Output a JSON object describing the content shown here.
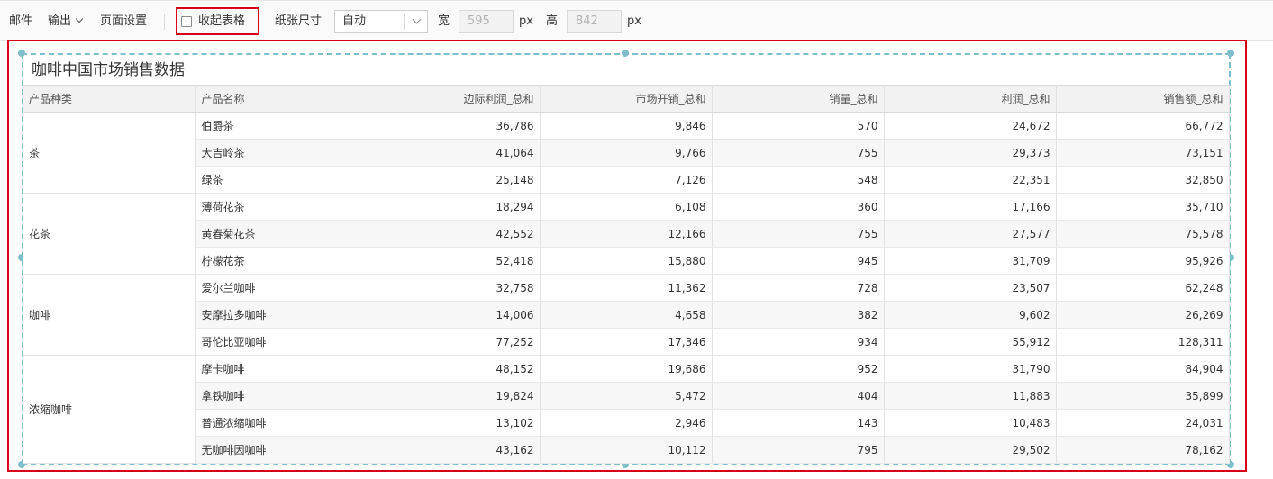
{
  "toolbar": {
    "mail": "邮件",
    "export": "输出",
    "page_settings": "页面设置",
    "collapse_table": "收起表格",
    "paper_size_label": "纸张尺寸",
    "paper_size_value": "自动",
    "width_label": "宽",
    "width_value": "595",
    "height_label": "高",
    "height_value": "842",
    "unit": "px"
  },
  "colors": {
    "highlight_border": "#d9001b",
    "selection_dashed": "#7fbfcc",
    "header_bg": "#f2f2f2",
    "stripe_bg": "#f7f7f7"
  },
  "report": {
    "title": "咖啡中国市场销售数据",
    "columns": [
      "产品种类",
      "产品名称",
      "边际利润_总和",
      "市场开销_总和",
      "销量_总和",
      "利润_总和",
      "销售额_总和"
    ],
    "groups": [
      {
        "category": "茶",
        "rows": [
          [
            "伯爵茶",
            "36,786",
            "9,846",
            "570",
            "24,672",
            "66,772"
          ],
          [
            "大吉岭茶",
            "41,064",
            "9,766",
            "755",
            "29,373",
            "73,151"
          ],
          [
            "绿茶",
            "25,148",
            "7,126",
            "548",
            "22,351",
            "32,850"
          ]
        ]
      },
      {
        "category": "花茶",
        "rows": [
          [
            "薄荷花茶",
            "18,294",
            "6,108",
            "360",
            "17,166",
            "35,710"
          ],
          [
            "黄春菊花茶",
            "42,552",
            "12,166",
            "755",
            "27,577",
            "75,578"
          ],
          [
            "柠檬花茶",
            "52,418",
            "15,880",
            "945",
            "31,709",
            "95,926"
          ]
        ]
      },
      {
        "category": "咖啡",
        "rows": [
          [
            "爱尔兰咖啡",
            "32,758",
            "11,362",
            "728",
            "23,507",
            "62,248"
          ],
          [
            "安摩拉多咖啡",
            "14,006",
            "4,658",
            "382",
            "9,602",
            "26,269"
          ],
          [
            "哥伦比亚咖啡",
            "77,252",
            "17,346",
            "934",
            "55,912",
            "128,311"
          ]
        ]
      },
      {
        "category": "浓缩咖啡",
        "rows": [
          [
            "摩卡咖啡",
            "48,152",
            "19,686",
            "952",
            "31,790",
            "84,904"
          ],
          [
            "拿铁咖啡",
            "19,824",
            "5,472",
            "404",
            "11,883",
            "35,899"
          ],
          [
            "普通浓缩咖啡",
            "13,102",
            "2,946",
            "143",
            "10,483",
            "24,031"
          ],
          [
            "无咖啡因咖啡",
            "43,162",
            "10,112",
            "795",
            "29,502",
            "78,162"
          ]
        ]
      }
    ]
  }
}
